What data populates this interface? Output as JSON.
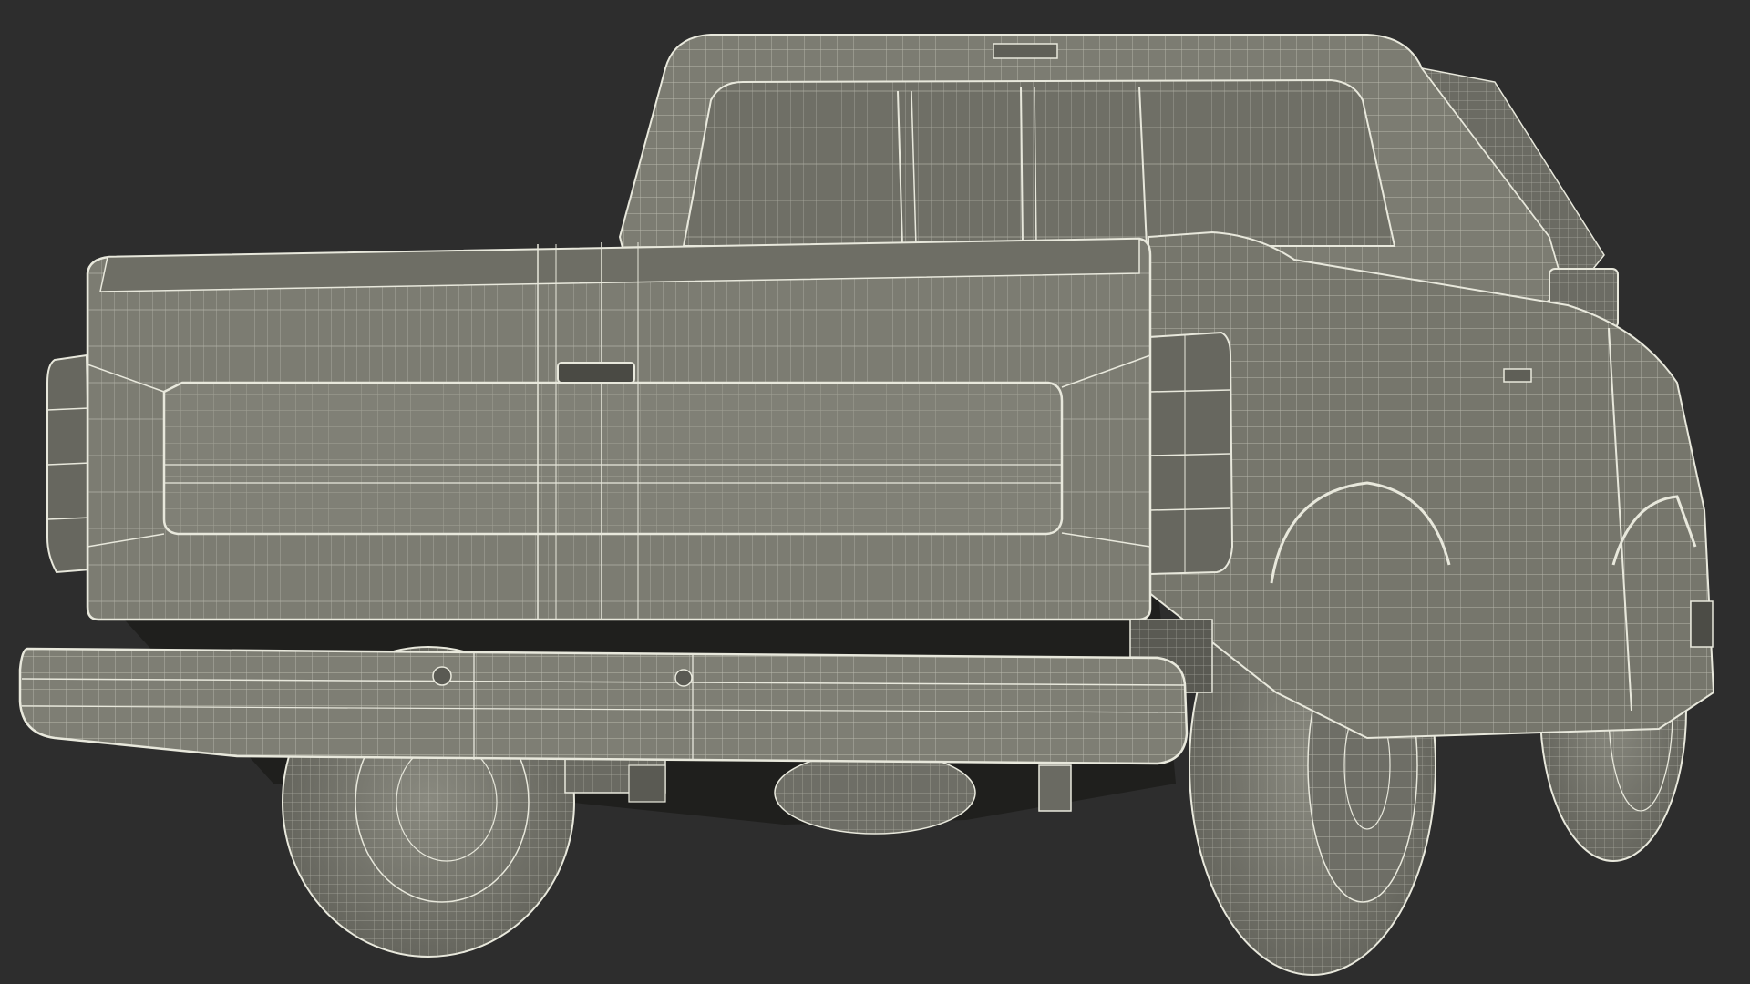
{
  "scene": {
    "subject": "pickup-truck-wireframe",
    "view": "rear-three-quarter",
    "colors": {
      "background": "#2d2d2d",
      "surface": "#7c7c72",
      "surface_dark": "#5f5f57",
      "surface_shadow": "#3a3a36",
      "wire": "#e8e8dc",
      "wire_dim": "#b9b9ac",
      "cavity": "#1f1f1d"
    }
  }
}
